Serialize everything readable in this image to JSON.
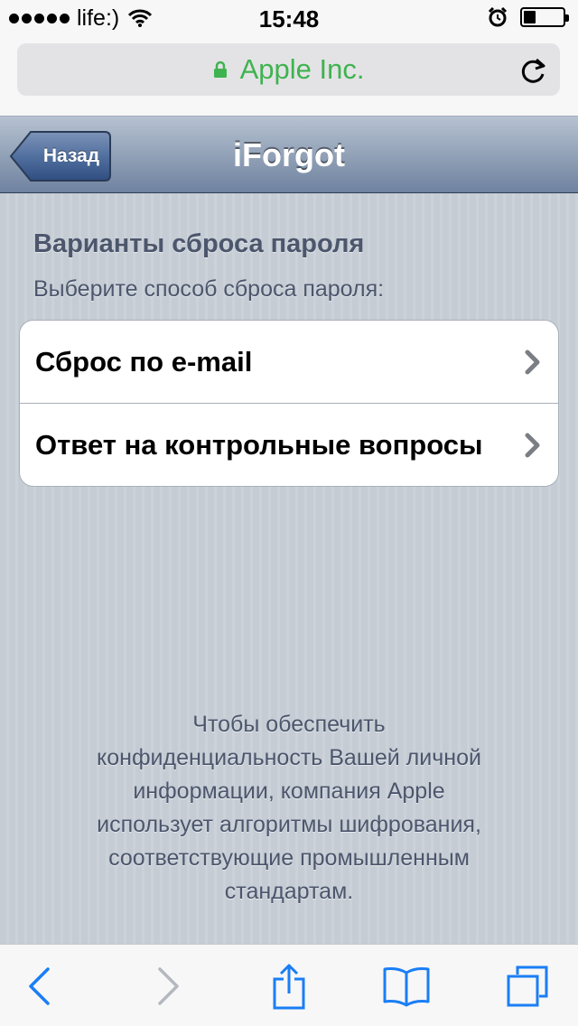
{
  "status_bar": {
    "carrier": "life:)",
    "time": "15:48",
    "battery_level": 0.3,
    "icons": [
      "signal-dots-icon",
      "wifi-icon",
      "alarm-clock-icon",
      "battery-icon"
    ]
  },
  "browser": {
    "url_label": "Apple Inc.",
    "secure_color": "#3fb34f",
    "accent_color": "#1a7ef5"
  },
  "nav_bar": {
    "back_label": "Назад",
    "title": "iForgot"
  },
  "content": {
    "section_title": "Варианты сброса пароля",
    "section_subtitle": "Выберите способ сброса пароля:",
    "options": [
      {
        "label": "Сброс по e-mail"
      },
      {
        "label": "Ответ на контрольные вопросы"
      }
    ],
    "footer_lines": [
      "Чтобы обеспечить",
      "конфиденциальность Вашей личной",
      "информации, компания Apple",
      "использует алгоритмы шифрования,",
      "соответствующие промышленным",
      "стандартам."
    ]
  },
  "toolbar": {
    "items": [
      "back-arrow-icon",
      "forward-arrow-icon",
      "share-icon",
      "bookmarks-icon",
      "tabs-icon"
    ]
  }
}
